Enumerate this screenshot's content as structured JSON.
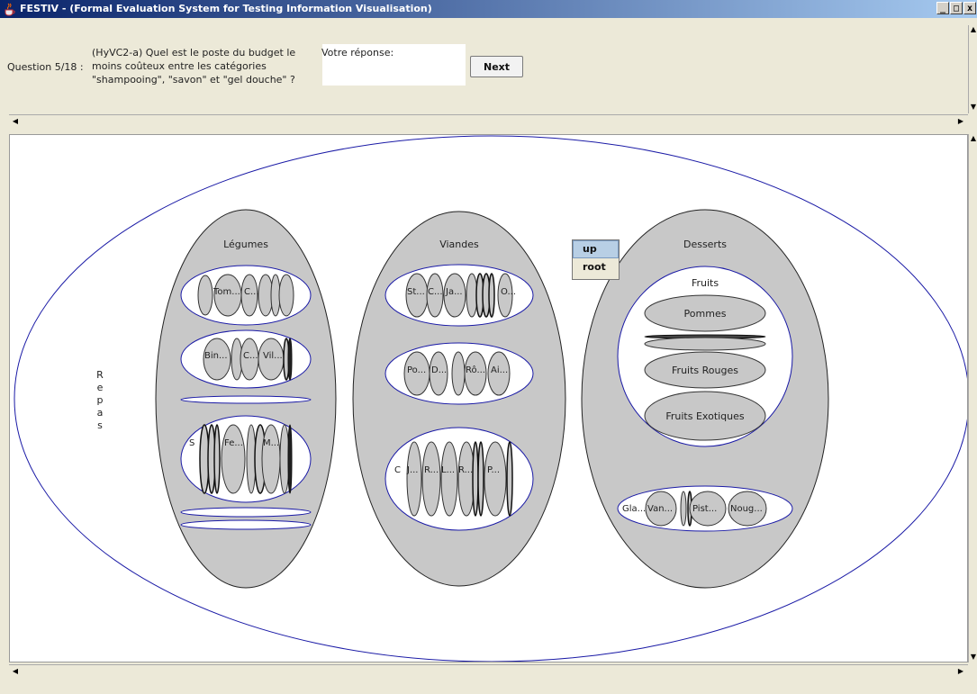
{
  "window": {
    "title": "FESTIV - (Formal Evaluation System for Testing Information Visualisation)",
    "controls": [
      "_",
      "□",
      "x"
    ]
  },
  "question": {
    "label": "Question 5/18 :",
    "text": "(HyVC2-a) Quel est le poste du budget le moins coûteux entre les catégories \"shampooing\", \"savon\" et \"gel douche\" ?",
    "answer_label": "Votre réponse:",
    "answer_value": "",
    "next_label": "Next"
  },
  "viz": {
    "root_label": "Repas",
    "legumes": {
      "label": "Légumes",
      "group1": [
        "Tom...",
        "C..."
      ],
      "group2": [
        "Bin...",
        "C...",
        "Vil..."
      ],
      "group3": [
        "S",
        "Fe...",
        "M..."
      ]
    },
    "viandes": {
      "label": "Viandes",
      "group1": [
        "St...",
        "C...",
        "Ja...",
        "O..."
      ],
      "group2": [
        "Po...",
        "D...",
        "Rô...",
        "Ai..."
      ],
      "group3": [
        "C",
        "J...",
        "R...",
        "L...",
        "R...",
        "P..."
      ]
    },
    "desserts": {
      "label": "Desserts",
      "fruits": {
        "label": "Fruits",
        "items": [
          "Pommes",
          "Fruits Rouges",
          "Fruits Exotiques"
        ]
      },
      "glaces": [
        "Gla...",
        "Van...",
        "Pist...",
        "Noug..."
      ]
    }
  },
  "context_menu": {
    "items": [
      "up",
      "root"
    ]
  },
  "colors": {
    "gray_fill": "#c8c8c8",
    "outline_blue": "#1a1aa6",
    "menu_selected": "#b8cfe5"
  }
}
